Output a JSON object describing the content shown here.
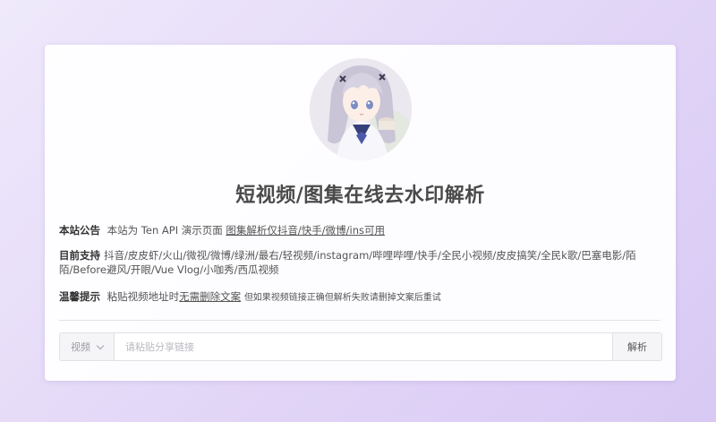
{
  "title": "短视频/图集在线去水印解析",
  "notice": {
    "label": "本站公告",
    "text": "本站为 Ten API 演示页面",
    "highlight": "图集解析仅抖音/快手/微博/ins可用"
  },
  "support": {
    "label": "目前支持",
    "text": "抖音/皮皮虾/火山/微视/微博/绿洲/最右/轻视频/instagram/哔哩哔哩/快手/全民小视频/皮皮搞笑/全民k歌/巴塞电影/陌陌/Before避风/开眼/Vue Vlog/小咖秀/西瓜视频"
  },
  "tip": {
    "label": "温馨提示",
    "text": "粘贴视频地址时",
    "highlight": "无需删除文案",
    "small": "但如果视频链接正确但解析失败请删掉文案后重试"
  },
  "form": {
    "type_selected": "视频",
    "input_placeholder": "请粘贴分享链接",
    "input_value": "",
    "button_label": "解析"
  }
}
